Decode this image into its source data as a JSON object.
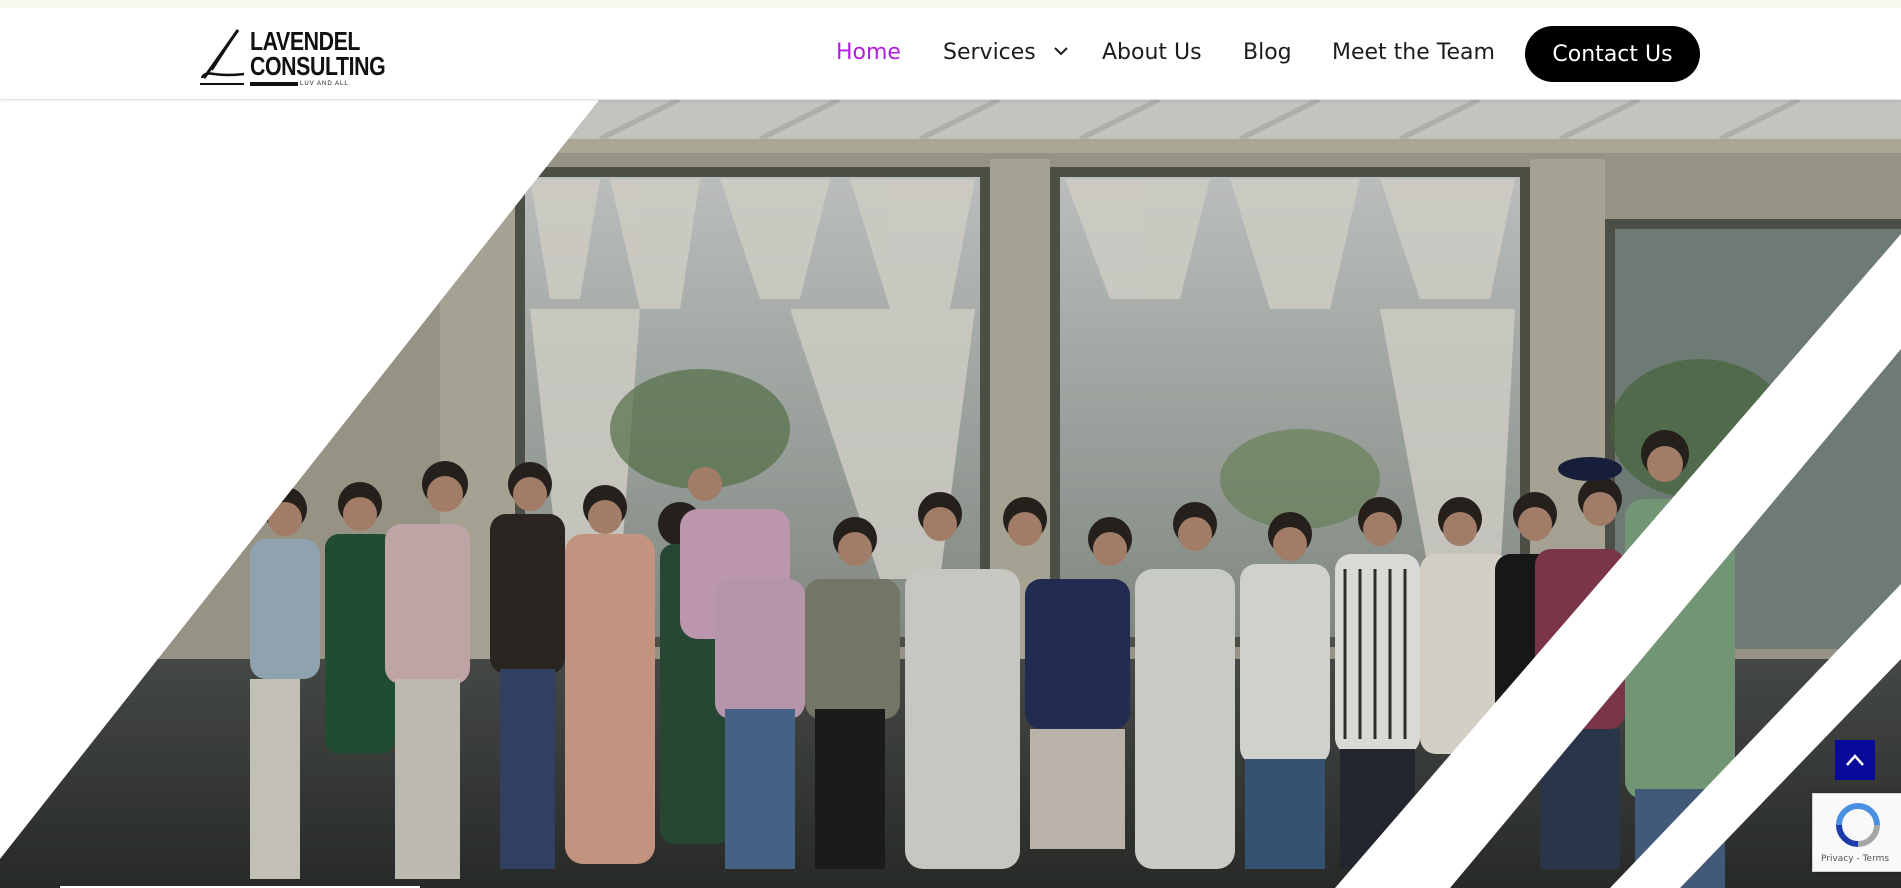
{
  "brand": {
    "line1": "LAVENDEL",
    "line2": "CONSULTING",
    "tagline": "LUV AND ALL",
    "logo_icon": "pen-stroke-logo-icon"
  },
  "nav": {
    "items": [
      {
        "label": "Home",
        "active": true
      },
      {
        "label": "Services",
        "has_dropdown": true,
        "icon": "chevron-down-icon"
      },
      {
        "label": "About Us"
      },
      {
        "label": "Blog"
      },
      {
        "label": "Meet the Team"
      }
    ],
    "contact_label": "Contact Us"
  },
  "hero": {
    "image": "team-group-photo"
  },
  "widgets": {
    "scroll_top_icon": "chevron-up-icon",
    "recaptcha": {
      "icon": "recaptcha-icon",
      "privacy": "Privacy",
      "separator": " - ",
      "terms": "Terms"
    }
  },
  "colors": {
    "active_nav": "#b21de0",
    "contact_button": "#000000",
    "scroll_top_button": "#0a0a9a"
  }
}
